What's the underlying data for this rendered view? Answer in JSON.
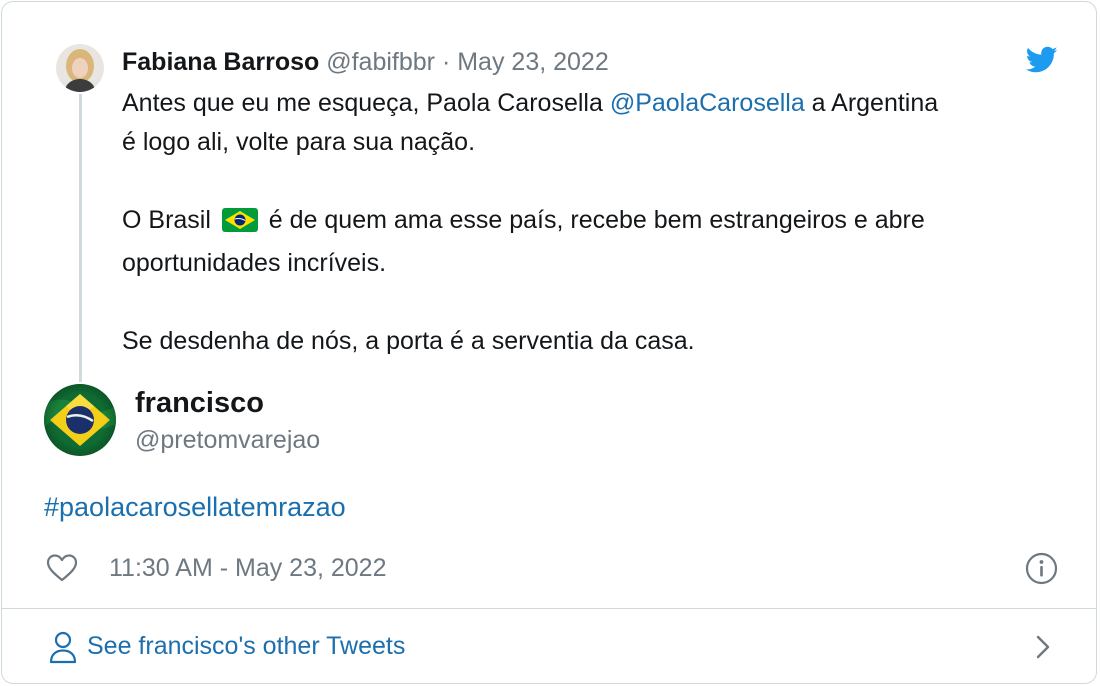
{
  "quoted_tweet": {
    "name": "Fabiana Barroso",
    "handle": "@fabifbbr",
    "separator": "·",
    "date": "May 23, 2022",
    "line1_pre": "Antes que eu me esqueça, Paola Carosella ",
    "mention": "@PaolaCarosella",
    "line1_post": " a Argentina",
    "line2": "é logo ali, volte para sua nação.",
    "para2_pre": "O Brasil ",
    "para2_post": " é de quem ama esse país, recebe bem estrangeiros e abre",
    "para2_line2": "oportunidades incríveis.",
    "para3": "Se desdenha de nós, a porta é a serventia da casa."
  },
  "tweet": {
    "name": "francisco",
    "handle": "@pretomvarejao",
    "hashtag": "#paolacarosellatemrazao",
    "timestamp": "11:30 AM - May 23, 2022"
  },
  "footer": {
    "other_tweets_label": "See francisco's other Tweets"
  },
  "colors": {
    "link": "#1b6fae",
    "twitter_blue": "#1d9bf0",
    "muted": "#6e7881",
    "border": "#cfd9de"
  }
}
